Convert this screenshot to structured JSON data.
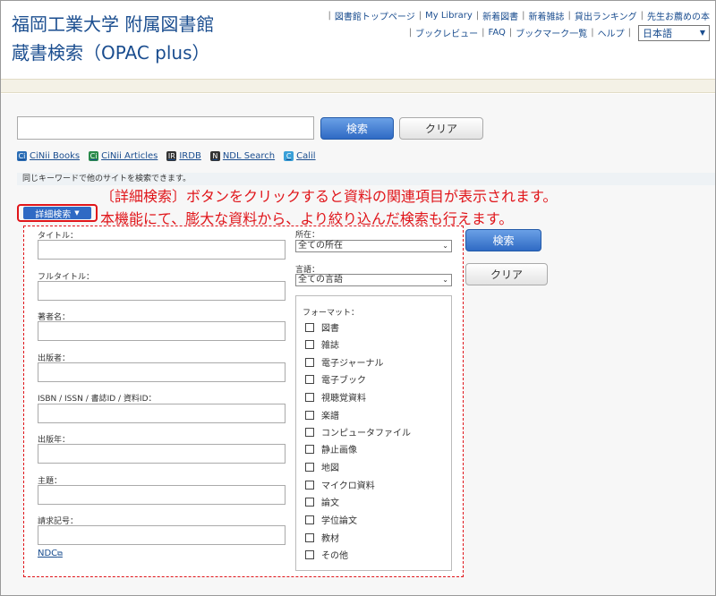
{
  "header": {
    "title_line1": "福岡工業大学 附属図書館",
    "title_line2": "蔵書検索（OPAC plus）",
    "links_row1": [
      "図書館トップページ",
      "My Library",
      "新着図書",
      "新着雑誌",
      "貸出ランキング",
      "先生お薦めの本"
    ],
    "links_row2": [
      "ブックレビュー",
      "FAQ",
      "ブックマーク一覧",
      "ヘルプ"
    ],
    "language": "日本語"
  },
  "search": {
    "search_label": "検索",
    "clear_label": "クリア"
  },
  "external": {
    "items": [
      "CiNii Books",
      "CiNii Articles",
      "IRDB",
      "NDL Search",
      "Calil"
    ],
    "hint": "同じキーワードで他のサイトを検索できます。"
  },
  "advanced": {
    "toggle_label": "詳細検索",
    "annotation_line1": "〔詳細検索〕ボタンをクリックすると資料の関連項目が表示されます。",
    "annotation_line2": "本機能にて、膨大な資料から、より絞り込んだ検索も行えます。",
    "fields": [
      "タイトル：",
      "フルタイトル：",
      "著者名：",
      "出版者：",
      "ISBN / ISSN / 書誌ID / 資料ID：",
      "出版年：",
      "主題：",
      "請求記号："
    ],
    "ndc_link": "NDC",
    "location_label": "所在：",
    "location_value": "全ての所在",
    "language_label": "言語：",
    "language_value": "全ての言語",
    "format_label": "フォーマット：",
    "formats": [
      "図書",
      "雑誌",
      "電子ジャーナル",
      "電子ブック",
      "視聴覚資料",
      "楽譜",
      "コンピュータファイル",
      "静止画像",
      "地図",
      "マイクロ資料",
      "論文",
      "学位論文",
      "教材",
      "その他"
    ],
    "search_label": "検索",
    "clear_label": "クリア"
  },
  "colors": {
    "brand": "#1a4d8f",
    "accent_button": "#2f6ac4",
    "annotation": "#e0151a"
  }
}
